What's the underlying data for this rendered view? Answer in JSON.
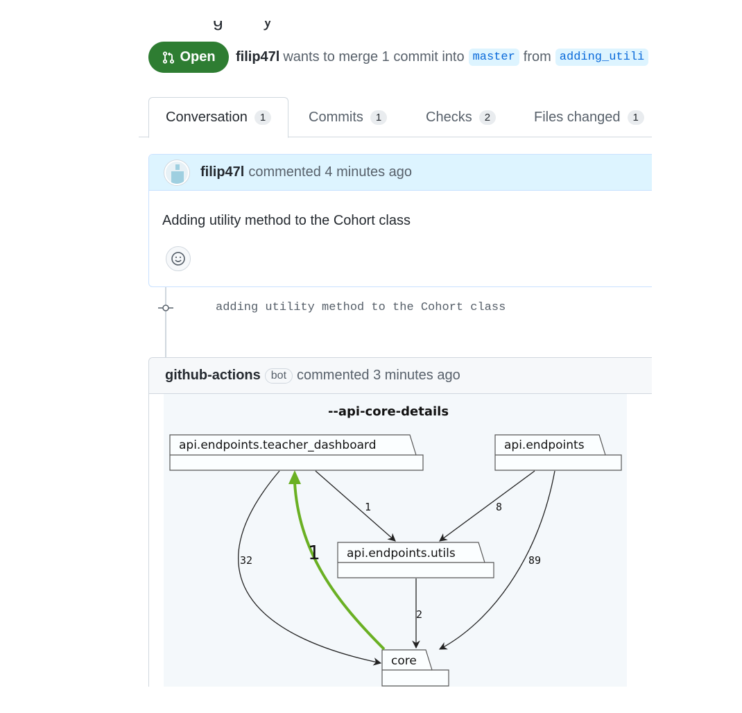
{
  "pr": {
    "state": "Open",
    "author": "filip47l",
    "merge_text": "wants to merge 1 commit into",
    "base_branch": "master",
    "from_text": "from",
    "head_branch": "adding_utili"
  },
  "tabs": [
    {
      "label": "Conversation",
      "count": "1"
    },
    {
      "label": "Commits",
      "count": "1"
    },
    {
      "label": "Checks",
      "count": "2"
    },
    {
      "label": "Files changed",
      "count": "1"
    }
  ],
  "comment": {
    "author": "filip47l",
    "meta": "commented 4 minutes ago",
    "body": "Adding utility method to the Cohort class",
    "avatar_icon": "identicon-avatar",
    "reaction_icon": "smiley-icon"
  },
  "commit": {
    "message": "adding utility method to the Cohort class",
    "icon": "git-commit-icon"
  },
  "bot_comment": {
    "author": "github-actions",
    "label": "bot",
    "meta": "commented 3 minutes ago"
  },
  "diagram": {
    "title": "--api-core-details",
    "packages": {
      "teacher_dashboard": "api.endpoints.teacher_dashboard",
      "endpoints": "api.endpoints",
      "utils": "api.endpoints.utils",
      "core": "core"
    },
    "edge_labels": {
      "td_utils": "1",
      "ep_utils": "8",
      "td_core": "32",
      "core_td": "1",
      "ep_core": "89",
      "utils_core": "2"
    },
    "colors": {
      "highlight": "#6ab023",
      "edge": "#222222",
      "package_fill": "#fbfeff",
      "background": "#f4f8fb"
    }
  },
  "colors": {
    "open_badge": "#2e7d32",
    "link_blue": "#0969da",
    "branch_bg": "#ddf4ff"
  }
}
